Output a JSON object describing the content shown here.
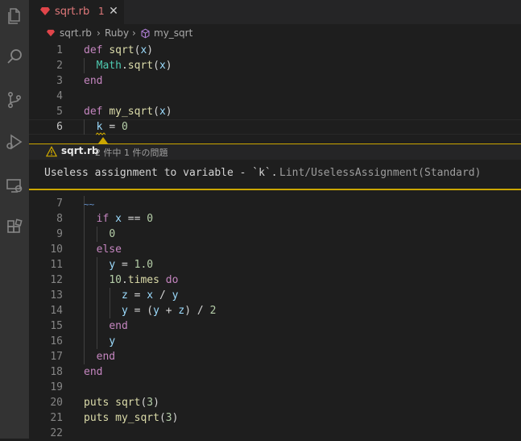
{
  "tab": {
    "file_name": "sqrt.rb",
    "problem_count": "1",
    "close_glyph": "✕"
  },
  "breadcrumb": {
    "file": "sqrt.rb",
    "sep": "›",
    "lang": "Ruby",
    "symbol": "my_sqrt"
  },
  "peek": {
    "file": "sqrt.rb",
    "summary": "2 件中 1 件の問題",
    "message": "Useless assignment to variable - `k`.",
    "source": "Lint/UselessAssignment(Standard)"
  },
  "line_numbers": [
    "1",
    "2",
    "3",
    "4",
    "5",
    "6",
    "7",
    "8",
    "9",
    "10",
    "11",
    "12",
    "13",
    "14",
    "15",
    "16",
    "17",
    "18",
    "19",
    "20",
    "21",
    "22"
  ],
  "code": {
    "l1": [
      "def",
      "sqrt",
      "(",
      "x",
      ")"
    ],
    "l2": [
      "Math",
      ".",
      "sqrt",
      "(",
      "x",
      ")"
    ],
    "l3": [
      "end"
    ],
    "l5": [
      "def",
      "my_sqrt",
      "(",
      "x",
      ")"
    ],
    "l6": [
      "k",
      "=",
      "0"
    ],
    "l7": [
      "~~"
    ],
    "l8": [
      "if",
      "x",
      "==",
      "0"
    ],
    "l9": [
      "0"
    ],
    "l10": [
      "else"
    ],
    "l11": [
      "y",
      "=",
      "1.0"
    ],
    "l12": [
      "10",
      ".",
      "times",
      "do"
    ],
    "l13": [
      "z",
      "=",
      "x",
      "/",
      "y"
    ],
    "l14": [
      "y",
      "=",
      "(",
      "y",
      "+",
      "z",
      ")",
      "/",
      "2"
    ],
    "l15": [
      "end"
    ],
    "l16": [
      "y"
    ],
    "l17": [
      "end"
    ],
    "l18": [
      "end"
    ],
    "l20": [
      "puts",
      "sqrt",
      "(",
      "3",
      ")"
    ],
    "l21": [
      "puts",
      "my_sqrt",
      "(",
      "3",
      ")"
    ]
  },
  "colors": {
    "warning": "#cca700",
    "ruby": "#e0454a",
    "keyword": "#c586c0",
    "function": "#dcdcaa",
    "variable": "#9cdcfe",
    "number": "#b5cea8"
  },
  "icons": [
    "files-icon",
    "search-icon",
    "source-control-icon",
    "run-debug-icon",
    "remote-explorer-icon",
    "extensions-icon",
    "ruby-icon",
    "close-icon",
    "symbol-method-icon",
    "warning-icon"
  ]
}
